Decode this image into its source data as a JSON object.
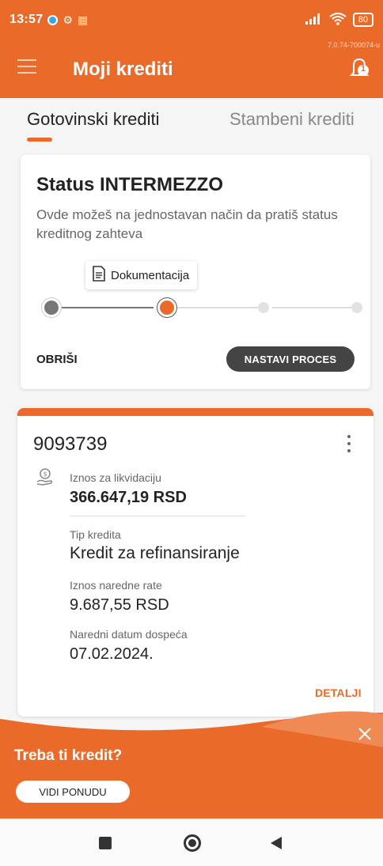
{
  "status_bar": {
    "time": "13:57",
    "battery": "80",
    "version": "7.0.74-700074-u"
  },
  "app_bar": {
    "title": "Moji krediti",
    "notification_count": "1"
  },
  "tabs": [
    {
      "label": "Gotovinski krediti",
      "active": true
    },
    {
      "label": "Stambeni krediti",
      "active": false
    }
  ],
  "status_card": {
    "title": "Status INTERMEZZO",
    "description": "Ovde možeš na jednostavan način da pratiš status kreditnog zahteva",
    "current_step_label": "Dokumentacija",
    "steps_total": 4,
    "current_step": 2,
    "delete_label": "OBRIŠI",
    "continue_label": "NASTAVI PROCES"
  },
  "loan_card": {
    "number": "9093739",
    "fields": [
      {
        "label": "Iznos za likvidaciju",
        "value": "366.647,19 RSD"
      },
      {
        "label": "Tip kredita",
        "value": "Kredit za refinansiranje"
      },
      {
        "label": "Iznos naredne rate",
        "value": "9.687,55 RSD"
      },
      {
        "label": "Naredni datum dospeća",
        "value": "07.02.2024."
      }
    ],
    "details_label": "DETALJI"
  },
  "promo": {
    "title": "Treba ti kredit?",
    "button_label": "VIDI PONUDU"
  },
  "colors": {
    "brand": "#ea6a2a",
    "dark": "#444444"
  }
}
